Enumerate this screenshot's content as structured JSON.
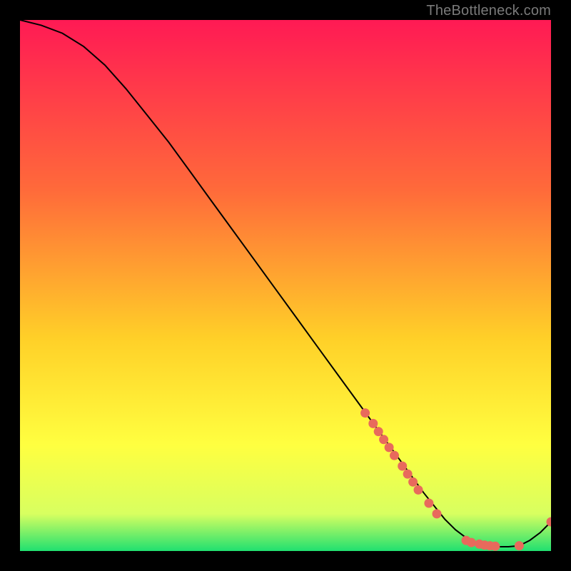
{
  "watermark": "TheBottleneck.com",
  "colors": {
    "gradient_top": "#ff1a54",
    "gradient_mid1": "#ff6a3a",
    "gradient_mid2": "#ffd028",
    "gradient_mid3": "#ffff40",
    "gradient_mid4": "#d8ff60",
    "gradient_bottom": "#20e070",
    "curve": "#000000",
    "marker": "#e86a5c"
  },
  "chart_data": {
    "type": "line",
    "title": "",
    "xlabel": "",
    "ylabel": "",
    "xlim": [
      0,
      100
    ],
    "ylim": [
      0,
      100
    ],
    "curve": {
      "x": [
        0,
        4,
        8,
        12,
        16,
        20,
        24,
        28,
        32,
        36,
        40,
        44,
        48,
        52,
        56,
        60,
        64,
        68,
        72,
        76,
        80,
        82,
        84,
        86,
        88,
        90,
        92,
        94,
        96,
        98,
        100
      ],
      "y": [
        100,
        99,
        97.5,
        95,
        91.5,
        87,
        82,
        77,
        71.5,
        66,
        60.5,
        55,
        49.5,
        44,
        38.5,
        33,
        27.5,
        22,
        16.5,
        11,
        6,
        4,
        2.5,
        1.5,
        1,
        0.8,
        0.8,
        1,
        2,
        3.5,
        5.5
      ]
    },
    "markers": [
      {
        "x": 65.0,
        "y": 26.0
      },
      {
        "x": 66.5,
        "y": 24.0
      },
      {
        "x": 67.5,
        "y": 22.5
      },
      {
        "x": 68.5,
        "y": 21.0
      },
      {
        "x": 69.5,
        "y": 19.5
      },
      {
        "x": 70.5,
        "y": 18.0
      },
      {
        "x": 72.0,
        "y": 16.0
      },
      {
        "x": 73.0,
        "y": 14.5
      },
      {
        "x": 74.0,
        "y": 13.0
      },
      {
        "x": 75.0,
        "y": 11.5
      },
      {
        "x": 77.0,
        "y": 9.0
      },
      {
        "x": 78.5,
        "y": 7.0
      },
      {
        "x": 84.0,
        "y": 2.0
      },
      {
        "x": 85.0,
        "y": 1.6
      },
      {
        "x": 86.5,
        "y": 1.3
      },
      {
        "x": 87.5,
        "y": 1.1
      },
      {
        "x": 88.5,
        "y": 1.0
      },
      {
        "x": 89.5,
        "y": 0.9
      },
      {
        "x": 94.0,
        "y": 1.0
      },
      {
        "x": 100.0,
        "y": 5.5
      }
    ]
  }
}
